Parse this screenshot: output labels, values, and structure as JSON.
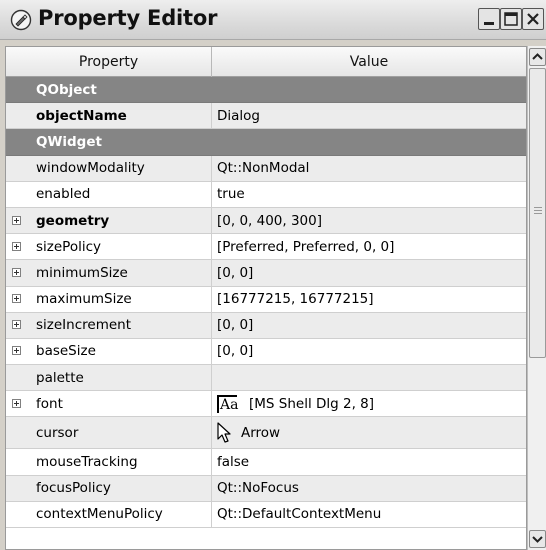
{
  "window": {
    "title": "Property Editor",
    "icon": "property-editor-icon",
    "controls": [
      "minimize",
      "maximize",
      "close"
    ]
  },
  "table": {
    "columns": {
      "property": "Property",
      "value": "Value"
    },
    "rows": [
      {
        "type": "group",
        "name": "QObject"
      },
      {
        "type": "prop",
        "name": "objectName",
        "value": "Dialog",
        "bold": true,
        "expandable": false
      },
      {
        "type": "group",
        "name": "QWidget"
      },
      {
        "type": "prop",
        "name": "windowModality",
        "value": "Qt::NonModal",
        "bold": false,
        "expandable": false
      },
      {
        "type": "prop",
        "name": "enabled",
        "value": "true",
        "bold": false,
        "expandable": false
      },
      {
        "type": "prop",
        "name": "geometry",
        "value": "[0, 0, 400, 300]",
        "bold": true,
        "expandable": true
      },
      {
        "type": "prop",
        "name": "sizePolicy",
        "value": "[Preferred, Preferred, 0, 0]",
        "bold": false,
        "expandable": true
      },
      {
        "type": "prop",
        "name": "minimumSize",
        "value": "[0, 0]",
        "bold": false,
        "expandable": true
      },
      {
        "type": "prop",
        "name": "maximumSize",
        "value": "[16777215, 16777215]",
        "bold": false,
        "expandable": true
      },
      {
        "type": "prop",
        "name": "sizeIncrement",
        "value": "[0, 0]",
        "bold": false,
        "expandable": true
      },
      {
        "type": "prop",
        "name": "baseSize",
        "value": "[0, 0]",
        "bold": false,
        "expandable": true
      },
      {
        "type": "prop",
        "name": "palette",
        "value": "",
        "bold": false,
        "expandable": false
      },
      {
        "type": "prop",
        "name": "font",
        "value": "[MS Shell Dlg 2, 8]",
        "bold": false,
        "expandable": true,
        "glyph": "Aa",
        "icon": "font-icon"
      },
      {
        "type": "prop",
        "name": "cursor",
        "value": "Arrow",
        "bold": false,
        "expandable": false,
        "icon": "arrow-cursor-icon",
        "tall": true
      },
      {
        "type": "prop",
        "name": "mouseTracking",
        "value": "false",
        "bold": false,
        "expandable": false
      },
      {
        "type": "prop",
        "name": "focusPolicy",
        "value": "Qt::NoFocus",
        "bold": false,
        "expandable": false
      },
      {
        "type": "prop",
        "name": "contextMenuPolicy",
        "value": "Qt::DefaultContextMenu",
        "bold": false,
        "expandable": false
      }
    ]
  },
  "colors": {
    "group_row": "#858585",
    "alt_row": "#ececec",
    "title_bar": "#dcdcdc"
  }
}
